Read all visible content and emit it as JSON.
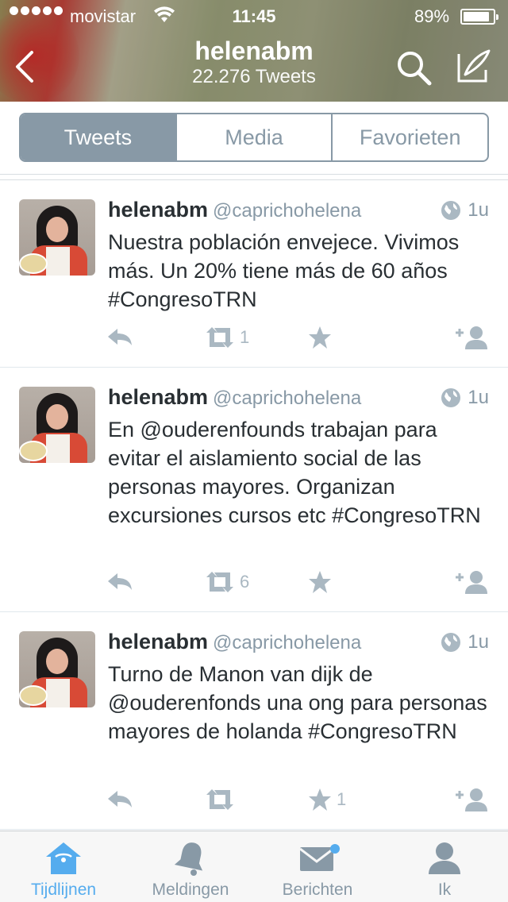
{
  "status_bar": {
    "carrier": "movistar",
    "time": "11:45",
    "battery": "89%",
    "battery_level": 0.89
  },
  "header": {
    "title": "helenabm",
    "subtitle": "22.276 Tweets"
  },
  "segments": [
    {
      "label": "Tweets",
      "active": true
    },
    {
      "label": "Media",
      "active": false
    },
    {
      "label": "Favorieten",
      "active": false
    }
  ],
  "tweets": [
    {
      "name": "helenabm",
      "handle": "@caprichohelena",
      "time": "1u",
      "text": "Nuestra población envejece. Vivimos más.  Un 20% tiene más de 60 años #CongresoTRN",
      "retweets": "1",
      "favorites": ""
    },
    {
      "name": "helenabm",
      "handle": "@caprichohelena",
      "time": "1u",
      "text": "En @ouderenfounds trabajan para evitar el aislamiento social de las personas mayores. Organizan excursiones cursos etc #CongresoTRN",
      "retweets": "6",
      "favorites": ""
    },
    {
      "name": "helenabm",
      "handle": "@caprichohelena",
      "time": "1u",
      "text": "Turno de Manon van dijk de @ouderenfonds una ong para personas mayores de holanda #CongresoTRN",
      "retweets": "",
      "favorites": "1"
    }
  ],
  "tabbar": [
    {
      "label": "Tijdlijnen",
      "icon": "home-icon",
      "active": true
    },
    {
      "label": "Meldingen",
      "icon": "bell-icon",
      "active": false
    },
    {
      "label": "Berichten",
      "icon": "envelope-icon",
      "active": false
    },
    {
      "label": "Ik",
      "icon": "person-icon",
      "active": false
    }
  ],
  "colors": {
    "accent": "#55acee",
    "segment_gray": "#8899a6",
    "text": "#292f33",
    "muted": "#aab8c2"
  }
}
